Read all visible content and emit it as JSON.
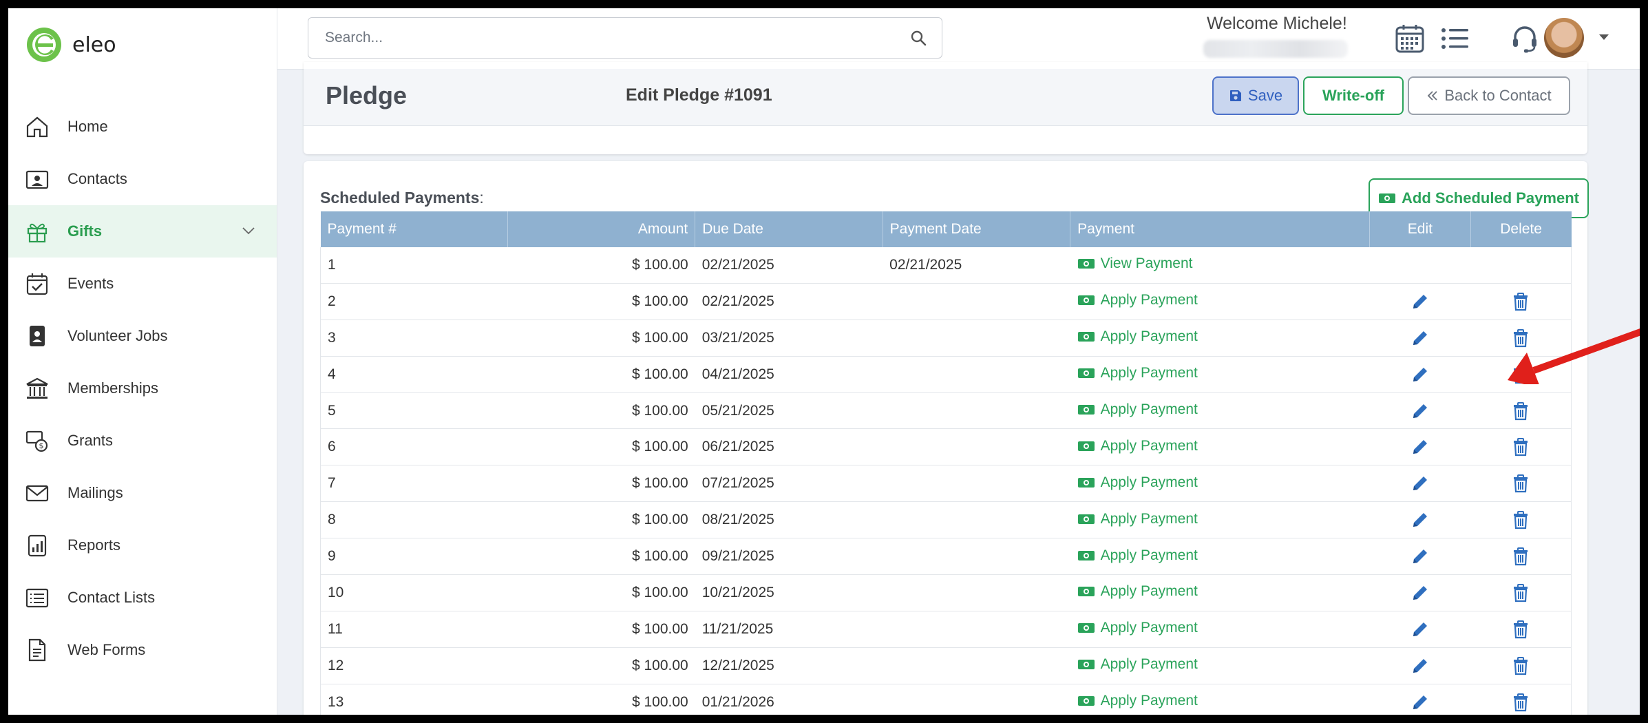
{
  "app": {
    "name": "eleo"
  },
  "sidebar": {
    "items": [
      {
        "label": "Home",
        "icon": "home-icon"
      },
      {
        "label": "Contacts",
        "icon": "contact-card-icon"
      },
      {
        "label": "Gifts",
        "icon": "gift-icon",
        "active": true
      },
      {
        "label": "Events",
        "icon": "calendar-check-icon"
      },
      {
        "label": "Volunteer Jobs",
        "icon": "id-badge-icon"
      },
      {
        "label": "Memberships",
        "icon": "building-columns-icon"
      },
      {
        "label": "Grants",
        "icon": "grant-dollar-icon"
      },
      {
        "label": "Mailings",
        "icon": "envelope-icon"
      },
      {
        "label": "Reports",
        "icon": "report-chart-icon"
      },
      {
        "label": "Contact Lists",
        "icon": "list-icon"
      },
      {
        "label": "Web Forms",
        "icon": "form-document-icon"
      }
    ]
  },
  "topbar": {
    "search_placeholder": "Search...",
    "welcome": "Welcome Michele!"
  },
  "pledge": {
    "title": "Pledge",
    "subtitle": "Edit Pledge #1091",
    "save_label": "Save",
    "writeoff_label": "Write-off",
    "back_label": "Back to Contact"
  },
  "schedule": {
    "title": "Scheduled Payments",
    "title_suffix": ":",
    "add_label": "Add Scheduled Payment",
    "columns": [
      "Payment #",
      "Amount",
      "Due Date",
      "Payment Date",
      "Payment",
      "Edit",
      "Delete"
    ],
    "rows": [
      {
        "num": "1",
        "amount": "$ 100.00",
        "due": "02/21/2025",
        "paid": "02/21/2025",
        "action": "View Payment",
        "editable": false
      },
      {
        "num": "2",
        "amount": "$ 100.00",
        "due": "02/21/2025",
        "paid": "",
        "action": "Apply Payment",
        "editable": true
      },
      {
        "num": "3",
        "amount": "$ 100.00",
        "due": "03/21/2025",
        "paid": "",
        "action": "Apply Payment",
        "editable": true
      },
      {
        "num": "4",
        "amount": "$ 100.00",
        "due": "04/21/2025",
        "paid": "",
        "action": "Apply Payment",
        "editable": true
      },
      {
        "num": "5",
        "amount": "$ 100.00",
        "due": "05/21/2025",
        "paid": "",
        "action": "Apply Payment",
        "editable": true
      },
      {
        "num": "6",
        "amount": "$ 100.00",
        "due": "06/21/2025",
        "paid": "",
        "action": "Apply Payment",
        "editable": true
      },
      {
        "num": "7",
        "amount": "$ 100.00",
        "due": "07/21/2025",
        "paid": "",
        "action": "Apply Payment",
        "editable": true
      },
      {
        "num": "8",
        "amount": "$ 100.00",
        "due": "08/21/2025",
        "paid": "",
        "action": "Apply Payment",
        "editable": true
      },
      {
        "num": "9",
        "amount": "$ 100.00",
        "due": "09/21/2025",
        "paid": "",
        "action": "Apply Payment",
        "editable": true
      },
      {
        "num": "10",
        "amount": "$ 100.00",
        "due": "10/21/2025",
        "paid": "",
        "action": "Apply Payment",
        "editable": true
      },
      {
        "num": "11",
        "amount": "$ 100.00",
        "due": "11/21/2025",
        "paid": "",
        "action": "Apply Payment",
        "editable": true
      },
      {
        "num": "12",
        "amount": "$ 100.00",
        "due": "12/21/2025",
        "paid": "",
        "action": "Apply Payment",
        "editable": true
      },
      {
        "num": "13",
        "amount": "$ 100.00",
        "due": "01/21/2026",
        "paid": "",
        "action": "Apply Payment",
        "editable": true
      }
    ]
  },
  "colors": {
    "brand_green": "#2aa35a",
    "header_blue": "#8fb1d0",
    "icon_blue": "#2f6fbf",
    "annotation_red": "#e0201b"
  }
}
